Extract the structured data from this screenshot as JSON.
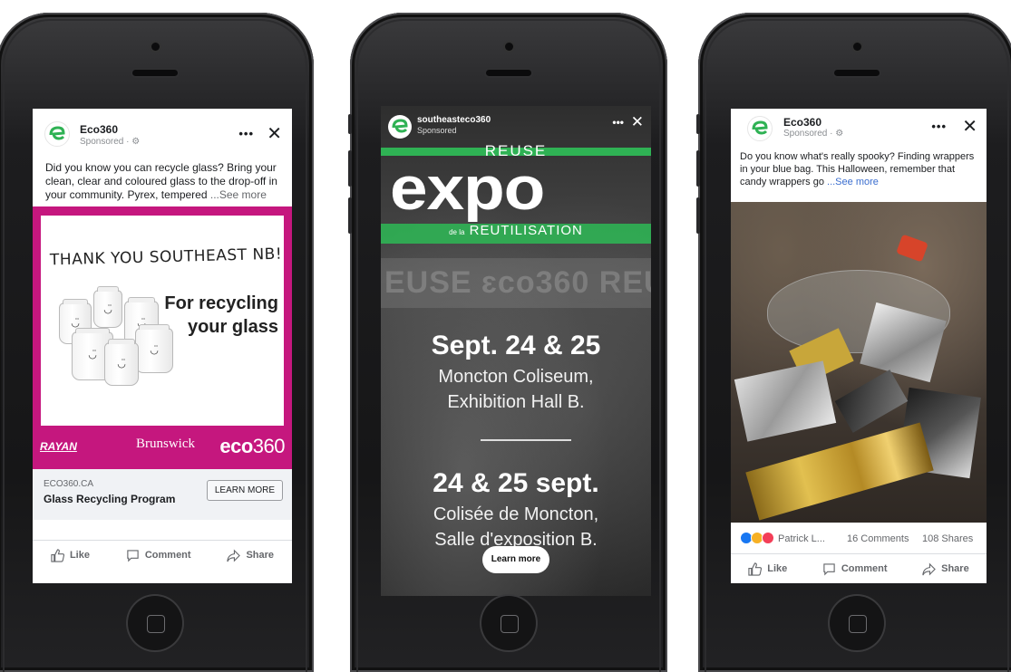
{
  "phone1": {
    "post": {
      "page_name": "Eco360",
      "sponsored": "Sponsored · ⚙",
      "text": "Did you know you can recycle glass? Bring your clean, clear and coloured glass to the drop-off in your community. Pyrex, tempered",
      "see_more": "...See more"
    },
    "creative": {
      "headline": "THANK YOU SOUTHEAST NB!",
      "tagline_1": "For recycling",
      "tagline_2": "your glass",
      "partner_1": "RAYAN",
      "partner_2": "Brunswick",
      "partner_3_bold": "eco",
      "partner_3_num": "360"
    },
    "link": {
      "domain": "ECO360.CA",
      "title": "Glass Recycling Program",
      "cta": "LEARN MORE"
    },
    "actions": {
      "like": "Like",
      "comment": "Comment",
      "share": "Share"
    }
  },
  "phone2": {
    "story": {
      "account": "southeasteco360",
      "sponsored": "Sponsored",
      "reuse": "REUSE",
      "expo": "expo",
      "reut_prefix": "de la",
      "reut": "REUTILISATION",
      "date_en": "Sept. 24 & 25",
      "venue_en_1": "Moncton Coliseum,",
      "venue_en_2": "Exhibition Hall B.",
      "date_fr": "24 & 25 sept.",
      "venue_fr_1": "Colisée de Moncton,",
      "venue_fr_2": "Salle d'exposition B.",
      "cta": "Learn more"
    }
  },
  "phone3": {
    "post": {
      "page_name": "Eco360",
      "sponsored": "Sponsored · ⚙",
      "text": "Do you know what's really spooky? Finding wrappers in your blue bag. This Halloween, remember that candy wrappers go",
      "see_more": "...See more"
    },
    "reactions": {
      "names": "Patrick L...",
      "comments": "16 Comments",
      "shares": "108 Shares"
    },
    "actions": {
      "like": "Like",
      "comment": "Comment",
      "share": "Share"
    }
  },
  "colors": {
    "magenta": "#c5177e",
    "eco_green": "#2fb254",
    "fb_link": "#65676b"
  }
}
